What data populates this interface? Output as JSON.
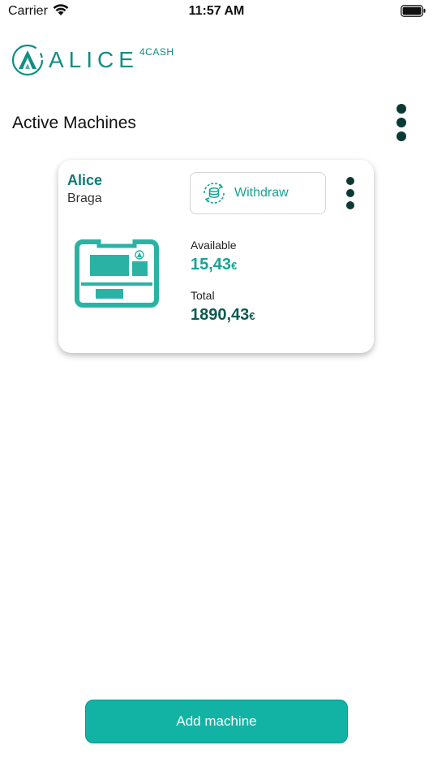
{
  "status_bar": {
    "carrier": "Carrier",
    "time": "11:57 AM",
    "wifi_icon": "wifi-icon",
    "battery_icon": "battery-full-icon"
  },
  "logo": {
    "text": "ALICE",
    "sub": "4CASH"
  },
  "page": {
    "title": "Active Machines",
    "menu_icon": "vertical-dots-icon"
  },
  "machine_card": {
    "name": "Alice",
    "location": "Braga",
    "withdraw_label": "Withdraw",
    "withdraw_icon": "coin-refresh-icon",
    "menu_icon": "vertical-dots-icon",
    "available_label": "Available",
    "available_value": "15,43",
    "total_label": "Total",
    "total_value": "1890,43",
    "currency": "€"
  },
  "actions": {
    "add_machine_label": "Add machine"
  },
  "colors": {
    "brand_teal": "#17a394",
    "dark_teal": "#0c5a51",
    "button_teal": "#12b3a4",
    "dot_color": "#0b3a34"
  }
}
